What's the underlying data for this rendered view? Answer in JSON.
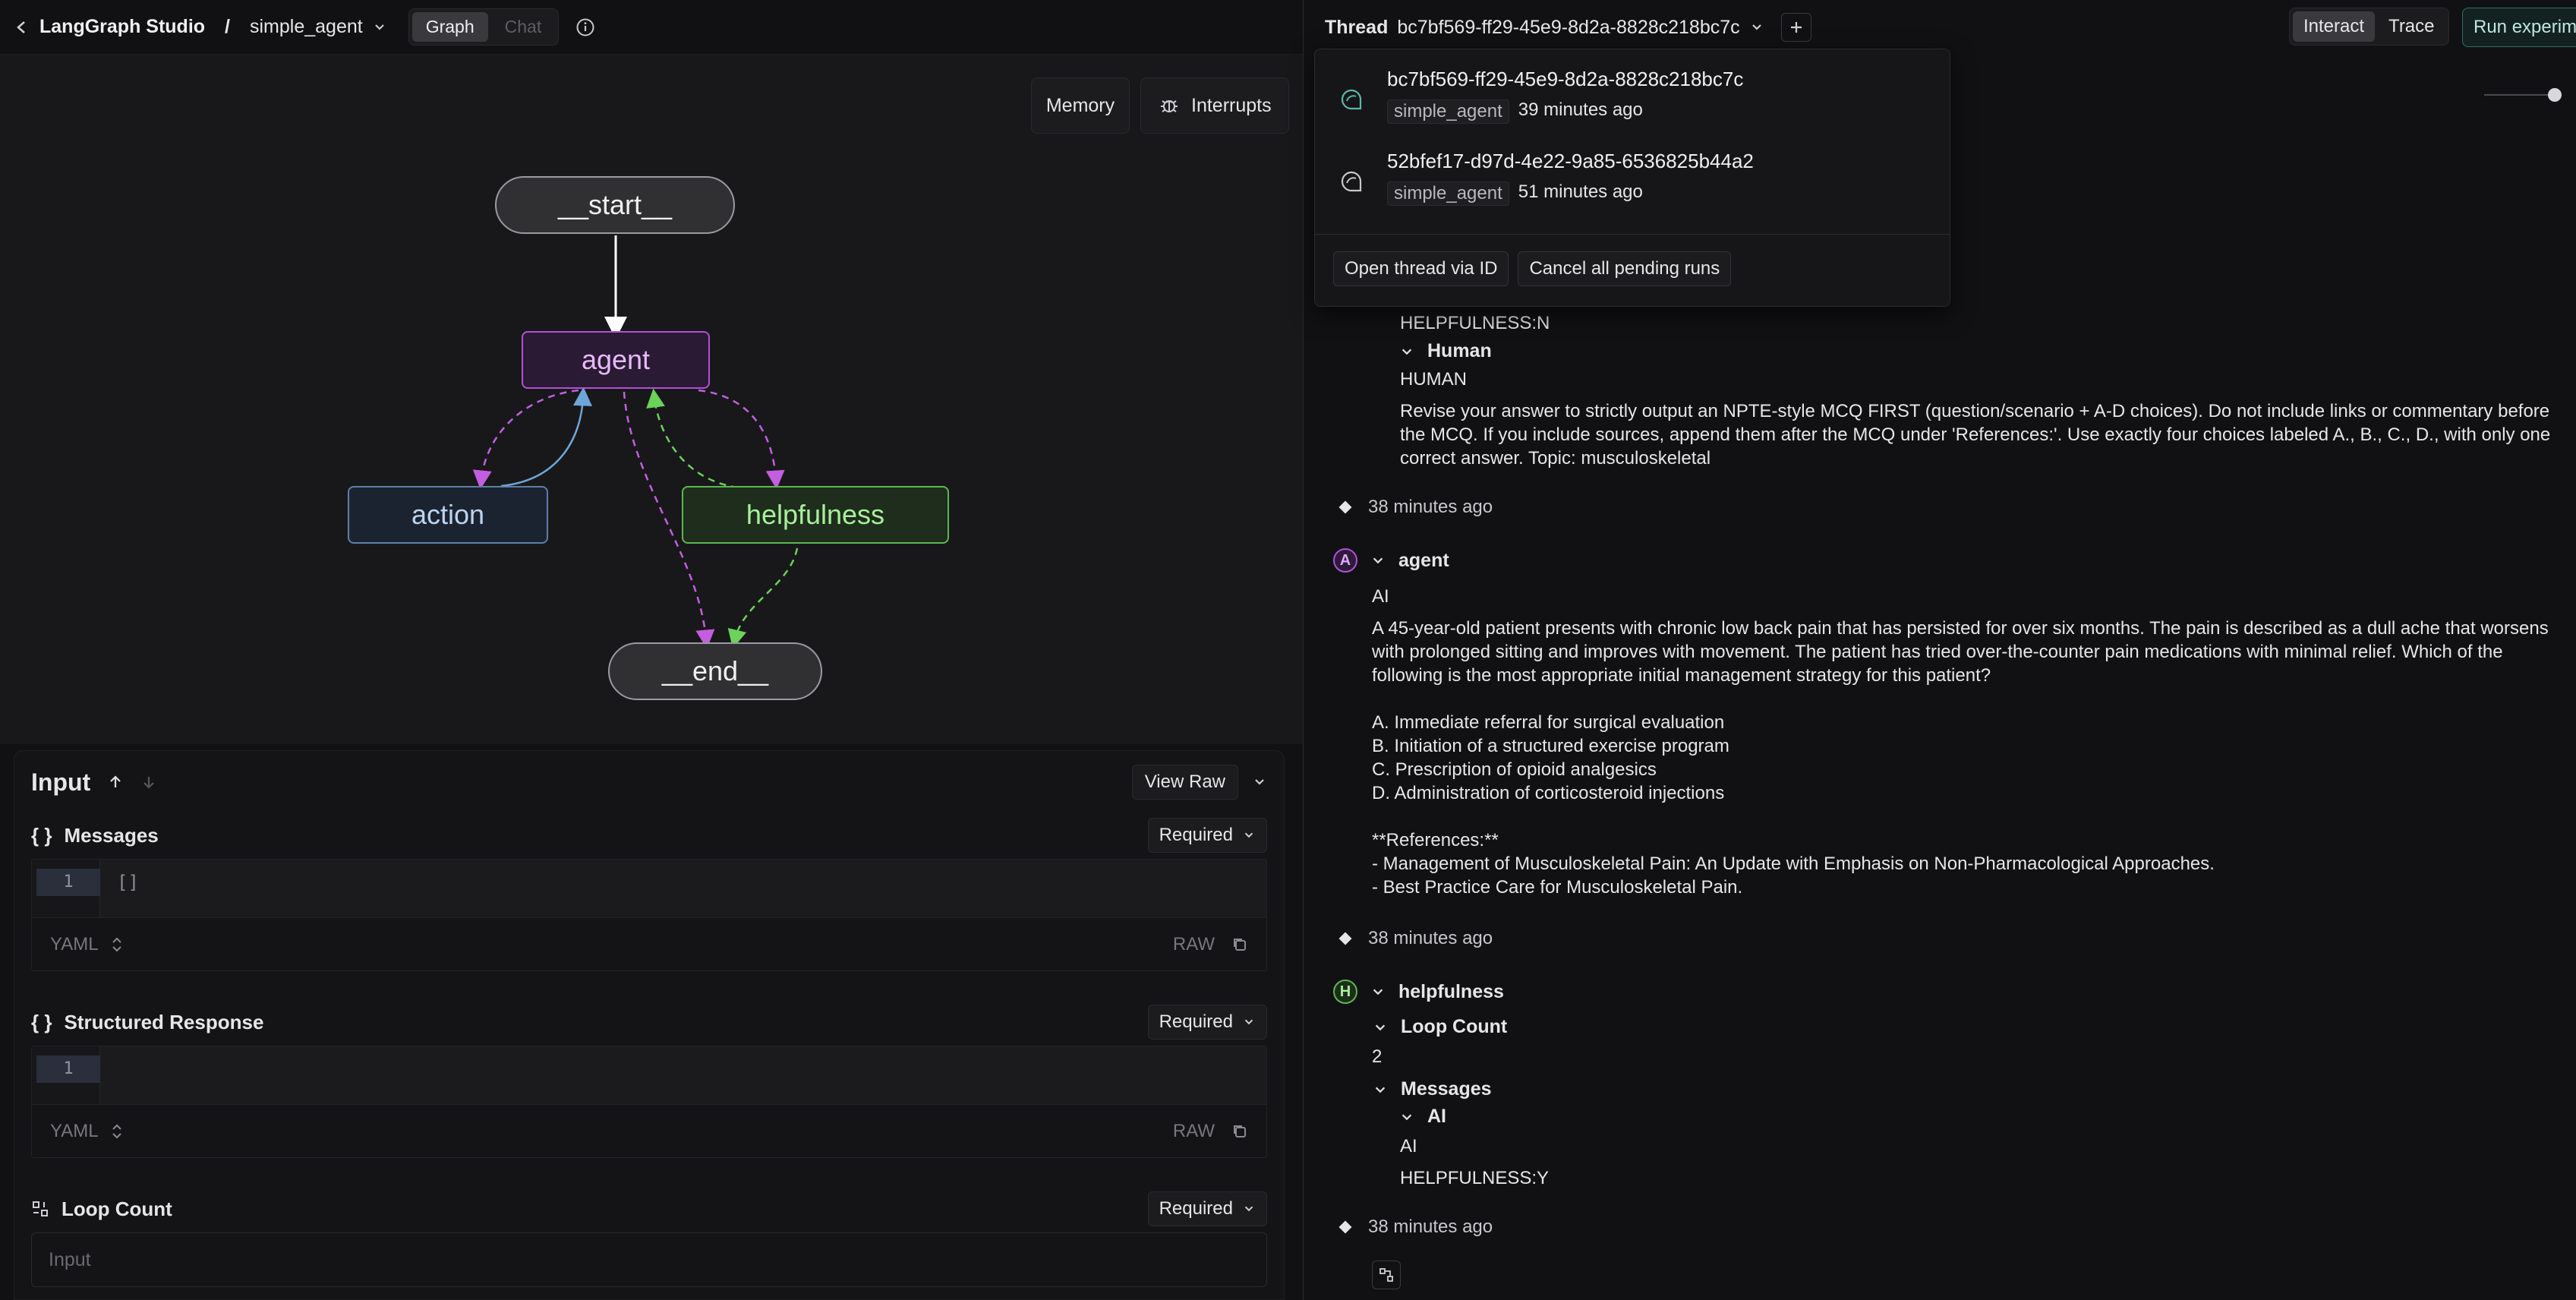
{
  "topbar": {
    "app_name": "LangGraph Studio",
    "separator": "/",
    "graph_name": "simple_agent",
    "tabs": [
      {
        "label": "Graph"
      },
      {
        "label": "Chat"
      }
    ]
  },
  "canvas": {
    "memory_label": "Memory",
    "interrupts_label": "Interrupts",
    "nodes": {
      "start": "__start__",
      "agent": "agent",
      "action": "action",
      "helpfulness": "helpfulness",
      "end": "__end__"
    }
  },
  "input_panel": {
    "title": "Input",
    "view_raw_label": "View Raw",
    "fields": [
      {
        "title": "Messages",
        "required": "Required",
        "line": "1",
        "code": "[]",
        "format": "YAML",
        "raw": "RAW"
      },
      {
        "title": "Structured Response",
        "required": "Required",
        "line": "1",
        "code": "",
        "format": "YAML",
        "raw": "RAW"
      },
      {
        "title": "Loop Count",
        "required": "Required",
        "placeholder": "Input"
      }
    ]
  },
  "right_topbar": {
    "thread_label": "Thread",
    "thread_id": "bc7bf569-ff29-45e9-8d2a-8828c218bc7c",
    "interact_label": "Interact",
    "trace_label": "Trace",
    "run_label": "Run experime"
  },
  "thread_dropdown": {
    "threads": [
      {
        "id": "bc7bf569-ff29-45e9-8d2a-8828c218bc7c",
        "graph": "simple_agent",
        "time": "39 minutes ago"
      },
      {
        "id": "52bfef17-d97d-4e22-9a85-6536825b44a2",
        "graph": "simple_agent",
        "time": "51 minutes ago"
      }
    ],
    "open_label": "Open thread via ID",
    "cancel_label": "Cancel all pending runs"
  },
  "chat": {
    "prev_helpfulness": "HELPFULNESS:N",
    "human_section": "Human",
    "human_role": "HUMAN",
    "human_text": "Revise your answer to strictly output an NPTE-style MCQ FIRST (question/scenario + A-D choices). Do not include links or commentary before the MCQ. If you include sources, append them after the MCQ under 'References:'. Use exactly four choices labeled A., B., C., D., with only one correct answer. Topic: musculoskeletal",
    "ts1": "38 minutes ago",
    "agent_name": "agent",
    "agent_avatar": "A",
    "agent_role": "AI",
    "agent_text": "A 45-year-old patient presents with chronic low back pain that has persisted for over six months. The pain is described as a dull ache that worsens with prolonged sitting and improves with movement. The patient has tried over-the-counter pain medications with minimal relief. Which of the following is the most appropriate initial management strategy for this patient?\n\nA. Immediate referral for surgical evaluation\nB. Initiation of a structured exercise program\nC. Prescription of opioid analgesics\nD. Administration of corticosteroid injections\n\n**References:**\n- Management of Musculoskeletal Pain: An Update with Emphasis on Non-Pharmacological Approaches.\n- Best Practice Care for Musculoskeletal Pain.",
    "ts2": "38 minutes ago",
    "helpfulness_name": "helpfulness",
    "helpfulness_avatar": "H",
    "loop_count_label": "Loop Count",
    "loop_count_value": "2",
    "messages_label": "Messages",
    "ai_section": "AI",
    "ai_role": "AI",
    "helpfulness_value": "HELPFULNESS:Y",
    "ts3": "38 minutes ago"
  }
}
